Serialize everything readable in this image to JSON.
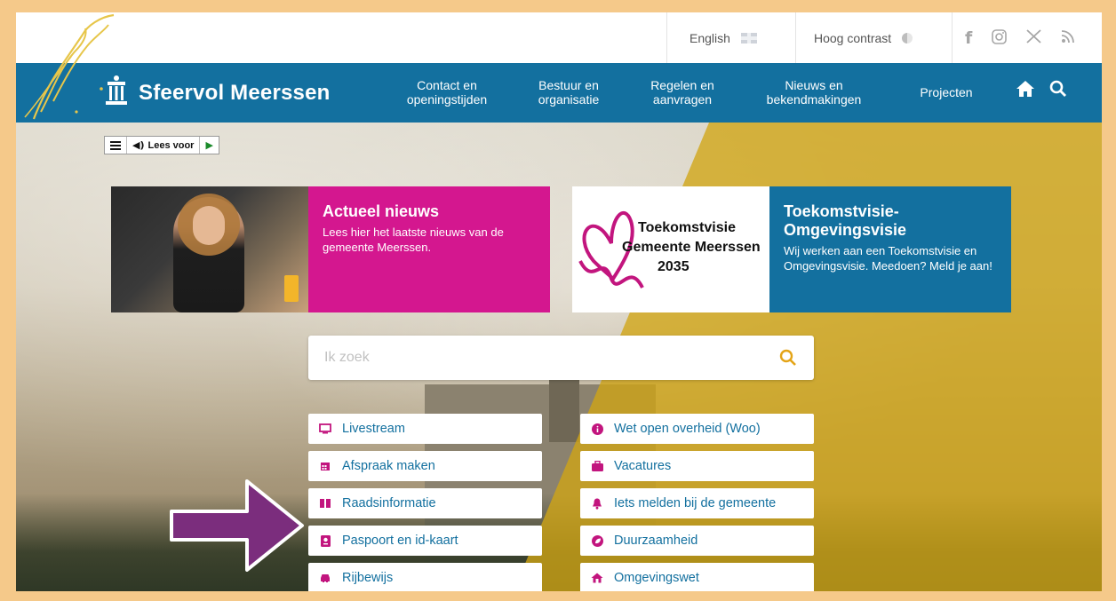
{
  "topbar": {
    "language_label": "English",
    "contrast_label": "Hoog contrast",
    "social_icons": [
      "facebook-icon",
      "instagram-icon",
      "x-icon",
      "rss-icon"
    ]
  },
  "nav": {
    "brand": "Sfeervol Meerssen",
    "items": [
      {
        "line1": "Contact en",
        "line2": "openingstijden"
      },
      {
        "line1": "Bestuur en",
        "line2": "organisatie"
      },
      {
        "line1": "Regelen en",
        "line2": "aanvragen"
      },
      {
        "line1": "Nieuws en",
        "line2": "bekendmakingen"
      },
      {
        "line1": "Projecten",
        "line2": ""
      }
    ]
  },
  "readspeaker": {
    "label": "Lees voor"
  },
  "cards": {
    "news": {
      "title": "Actueel nieuws",
      "text": "Lees hier het laatste nieuws van de gemeente Meerssen."
    },
    "vision": {
      "image_line1": "Toekomstvisie",
      "image_line2": "Gemeente Meerssen",
      "image_line3": "2035",
      "title": "Toekomstvisie-Omgevingsvisie",
      "text": "Wij werken aan een Toekomstvisie en Omgevingsvisie. Meedoen? Meld je aan!"
    }
  },
  "search": {
    "placeholder": "Ik zoek"
  },
  "quicklinks": {
    "left": [
      {
        "label": "Livestream",
        "icon": "monitor-icon"
      },
      {
        "label": "Afspraak maken",
        "icon": "calendar-icon"
      },
      {
        "label": "Raadsinformatie",
        "icon": "book-icon"
      },
      {
        "label": "Paspoort en id-kaart",
        "icon": "passport-icon"
      },
      {
        "label": "Rijbewijs",
        "icon": "car-icon"
      }
    ],
    "right": [
      {
        "label": "Wet open overheid (Woo)",
        "icon": "info-icon"
      },
      {
        "label": "Vacatures",
        "icon": "briefcase-icon"
      },
      {
        "label": "Iets melden bij de gemeente",
        "icon": "bell-icon"
      },
      {
        "label": "Duurzaamheid",
        "icon": "leaf-icon"
      },
      {
        "label": "Omgevingswet",
        "icon": "house-icon"
      }
    ]
  },
  "colors": {
    "nav_blue": "#13709f",
    "magenta": "#d4178f",
    "link_blue": "#13709f",
    "icon_magenta": "#c2157e",
    "search_icon": "#e4a417",
    "frame": "#f5c98a"
  }
}
